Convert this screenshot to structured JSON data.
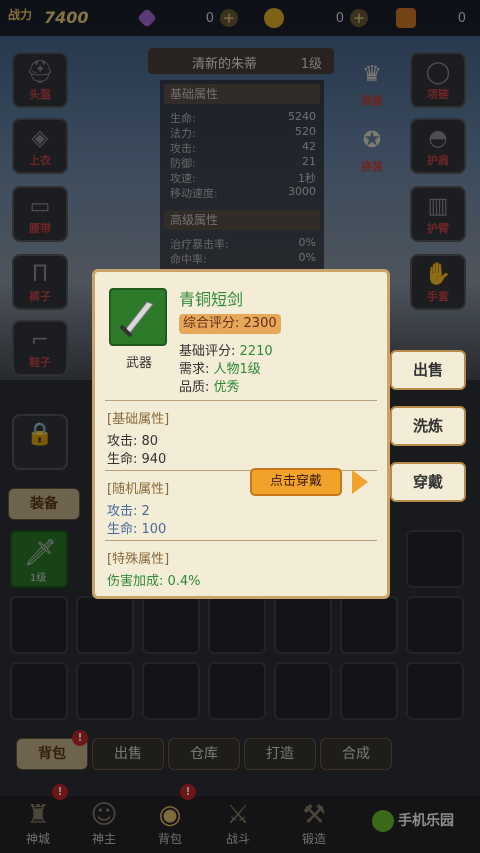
{
  "top_bar": {
    "power_label": "战力",
    "power_value": "7400",
    "resources": [
      {
        "icon": "diamond-icon",
        "value": "0",
        "color": "#a06ad4"
      },
      {
        "icon": "gold-coin-icon",
        "value": "0",
        "color": "#e6b22a"
      },
      {
        "icon": "ticket-icon",
        "value": "0",
        "color": "#d27a2a"
      }
    ]
  },
  "equip_slots_left": [
    {
      "label": "头盔",
      "icon": "helmet-icon"
    },
    {
      "label": "上衣",
      "icon": "armor-icon"
    },
    {
      "label": "腰带",
      "icon": "belt-icon"
    },
    {
      "label": "裤子",
      "icon": "pants-icon"
    },
    {
      "label": "鞋子",
      "icon": "boots-icon"
    }
  ],
  "equip_slots_right": [
    {
      "label": "项链",
      "icon": "necklace-icon"
    },
    {
      "label": "护肩",
      "icon": "shoulder-icon"
    },
    {
      "label": "护臂",
      "icon": "bracer-icon"
    },
    {
      "label": "手套",
      "icon": "glove-icon"
    }
  ],
  "side_actions": [
    {
      "label": "装备",
      "icon": "equip-icon"
    },
    {
      "label": "换装",
      "icon": "outfit-icon"
    }
  ],
  "character": {
    "name": "清新的朱蒂",
    "level": "1级",
    "basic_header": "基础属性",
    "basic_stats": [
      {
        "name": "生命:",
        "value": "5240"
      },
      {
        "name": "法力:",
        "value": "520"
      },
      {
        "name": "攻击:",
        "value": "42"
      },
      {
        "name": "防御:",
        "value": "21"
      },
      {
        "name": "攻速:",
        "value": "1秒"
      },
      {
        "name": "移动速度:",
        "value": "3000"
      }
    ],
    "advanced_header": "高级属性",
    "advanced_stats": [
      {
        "name": "治疗暴击率:",
        "value": "0%"
      },
      {
        "name": "命中率:",
        "value": "0%"
      }
    ]
  },
  "bag_tabs": {
    "equip_tab": "装备"
  },
  "bag_item": {
    "level": "1级"
  },
  "bottom_tabs": [
    {
      "label": "背包",
      "active": true,
      "badge": "!"
    },
    {
      "label": "出售",
      "active": false
    },
    {
      "label": "仓库",
      "active": false
    },
    {
      "label": "打造",
      "active": false
    },
    {
      "label": "合成",
      "active": false
    }
  ],
  "nav": [
    {
      "label": "神城",
      "icon": "castle-icon",
      "badge": "!"
    },
    {
      "label": "神主",
      "icon": "hero-icon"
    },
    {
      "label": "背包",
      "icon": "bag-icon",
      "badge": "!"
    },
    {
      "label": "战斗",
      "icon": "battle-icon"
    },
    {
      "label": "锻造",
      "icon": "forge-icon"
    },
    {
      "label": "",
      "icon": "more-icon"
    }
  ],
  "popup": {
    "item_name": "青铜短剑",
    "item_type": "武器",
    "score_label": "综合评分:",
    "score_value": "2300",
    "base_score_label": "基础评分:",
    "base_score_value": "2210",
    "requirement_label": "需求:",
    "requirement_value": "人物1级",
    "quality_label": "品质:",
    "quality_value": "优秀",
    "basic_header": "[基础属性]",
    "basic_lines": [
      "攻击: 80",
      "生命: 940"
    ],
    "random_header": "[随机属性]",
    "random_lines": [
      "攻击: 2",
      "生命: 100"
    ],
    "special_header": "[特殊属性]",
    "special_lines": [
      "伤害加成: 0.4%"
    ]
  },
  "popup_actions": {
    "sell": "出售",
    "refine": "洗炼",
    "wear": "穿戴",
    "wear_hint": "点击穿戴"
  },
  "watermark": "手机乐园"
}
